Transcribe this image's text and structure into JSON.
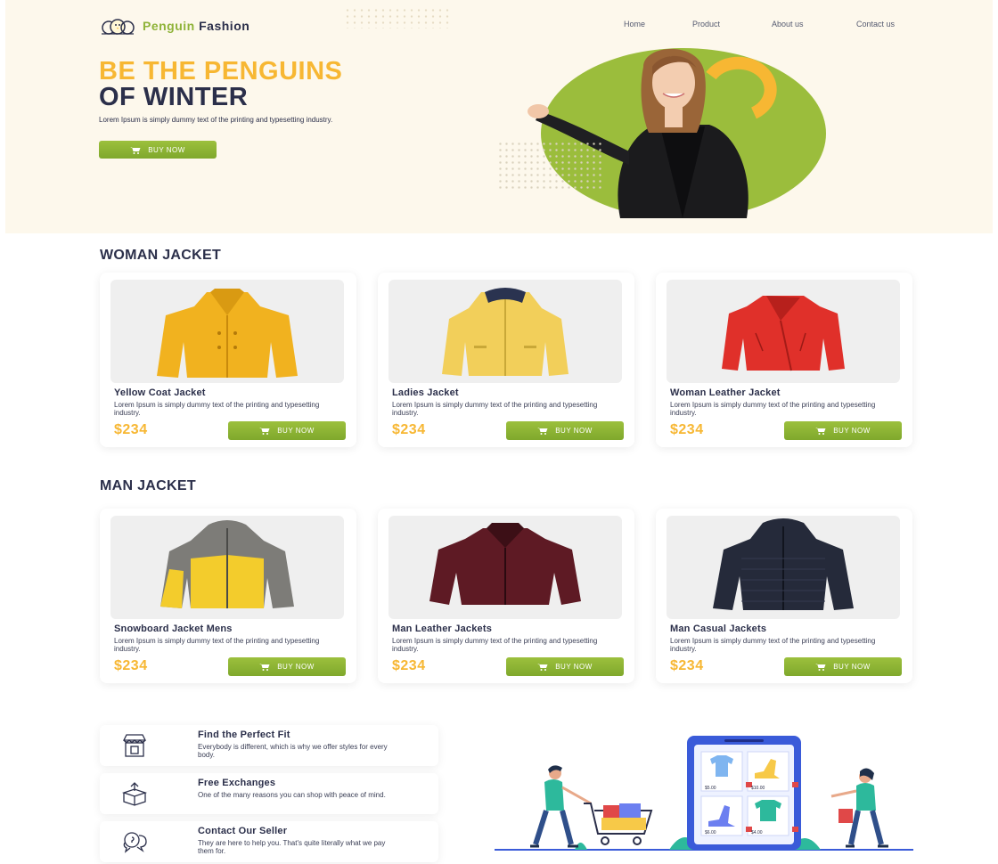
{
  "header": {
    "brand_part1": "Penguin",
    "brand_part2": "Fashion",
    "nav": [
      "Home",
      "Product",
      "About us",
      "Contact us"
    ]
  },
  "hero": {
    "title_line1": "BE THE PENGUINS",
    "title_line2": "OF WINTER",
    "description": "Lorem Ipsum is simply dummy text of the printing and typesetting industry.",
    "button_label": "BUY NOW"
  },
  "sections": [
    {
      "title": "WOMAN JACKET",
      "products": [
        {
          "name": "Yellow Coat Jacket",
          "description": "Lorem Ipsum is simply dummy text of the printing and typesetting industry.",
          "price": "$234",
          "button_label": "BUY NOW"
        },
        {
          "name": "Ladies Jacket",
          "description": "Lorem Ipsum is simply dummy text of the printing and typesetting industry.",
          "price": "$234",
          "button_label": "BUY NOW"
        },
        {
          "name": "Woman Leather Jacket",
          "description": "Lorem Ipsum is simply dummy text of the printing and typesetting industry.",
          "price": "$234",
          "button_label": "BUY NOW"
        }
      ]
    },
    {
      "title": "MAN JACKET",
      "products": [
        {
          "name": "Snowboard Jacket Mens",
          "description": "Lorem Ipsum is simply dummy text of the printing and typesetting industry.",
          "price": "$234",
          "button_label": "BUY NOW"
        },
        {
          "name": "Man Leather Jackets",
          "description": "Lorem Ipsum is simply dummy text of the printing and typesetting industry.",
          "price": "$234",
          "button_label": "BUY NOW"
        },
        {
          "name": "Man Casual Jackets",
          "description": "Lorem Ipsum is simply dummy text of the printing and typesetting industry.",
          "price": "$234",
          "button_label": "BUY NOW"
        }
      ]
    }
  ],
  "features": [
    {
      "title": "Find the Perfect Fit",
      "description": "Everybody is different, which is why we offer styles for every body.",
      "icon": "store-icon"
    },
    {
      "title": "Free Exchanges",
      "description": "One of the many reasons you can shop with peace of mind.",
      "icon": "exchange-box-icon"
    },
    {
      "title": "Contact Our Seller",
      "description": "They are here to help you. That's quite literally what we pay them for.",
      "icon": "support-chat-icon"
    }
  ],
  "illustration": {
    "prices": [
      "$5.00",
      "$10.00",
      "$6.00",
      "$4.00"
    ]
  },
  "colors": {
    "accent_green": "#8fb339",
    "accent_yellow": "#f7b733",
    "navy": "#2b2f4a",
    "hero_bg": "#fdf8ec"
  }
}
